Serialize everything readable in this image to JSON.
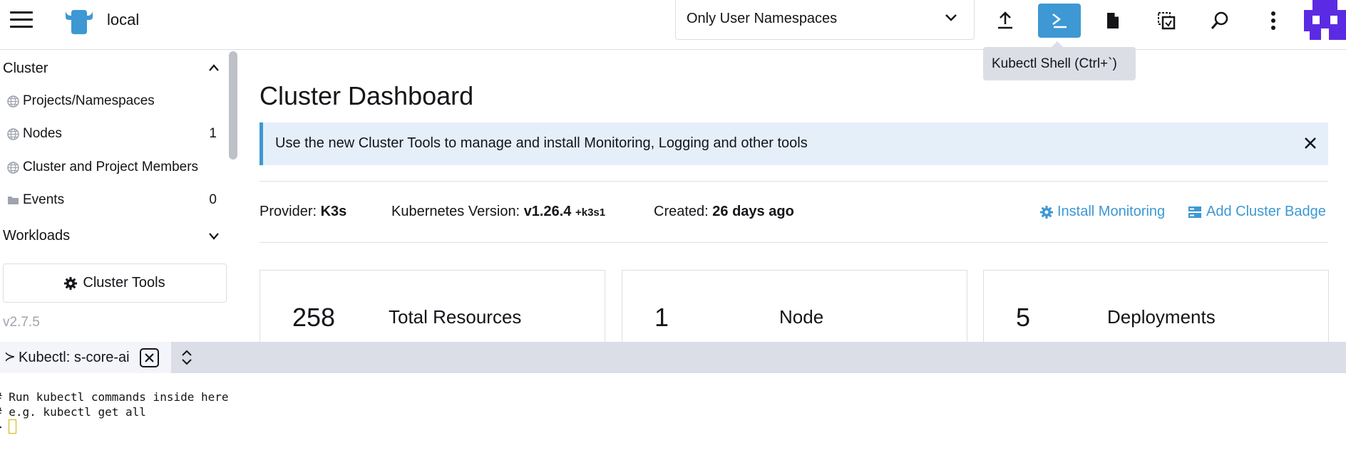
{
  "header": {
    "cluster_name": "local",
    "namespace_filter": "Only User Namespaces",
    "tooltip": "Kubectl Shell (Ctrl+`)",
    "colors": {
      "accent": "#3d98d3",
      "avatar": "#5b2be3"
    },
    "buttons": [
      {
        "name": "import-yaml",
        "icon": "upload-icon"
      },
      {
        "name": "kubectl-shell",
        "icon": "terminal-icon",
        "active": true
      },
      {
        "name": "kubeconfig-download",
        "icon": "file-icon"
      },
      {
        "name": "copy-kubeconfig",
        "icon": "copy-icon"
      },
      {
        "name": "resource-search",
        "icon": "search-icon"
      },
      {
        "name": "more-actions",
        "icon": "more-vertical-icon"
      }
    ]
  },
  "sidebar": {
    "group_cluster": "Cluster",
    "items": [
      {
        "label": "Projects/Namespaces",
        "count": "",
        "icon": "globe-icon"
      },
      {
        "label": "Nodes",
        "count": "1",
        "icon": "globe-icon"
      },
      {
        "label": "Cluster and Project Members",
        "count": "",
        "icon": "globe-icon"
      },
      {
        "label": "Events",
        "count": "0",
        "icon": "folder-icon"
      }
    ],
    "group_workloads": "Workloads",
    "cluster_tools_label": "Cluster Tools",
    "version": "v2.7.5"
  },
  "main": {
    "title": "Cluster Dashboard",
    "banner": "Use the new Cluster Tools to manage and install Monitoring, Logging and other tools",
    "meta": {
      "provider_label": "Provider:",
      "provider_value": "K3s",
      "k8s_label": "Kubernetes Version:",
      "k8s_value": "v1.26.4",
      "k8s_suffix": "+k3s1",
      "created_label": "Created:",
      "created_value": "26 days ago"
    },
    "links": {
      "install_monitoring": "Install Monitoring",
      "add_badge": "Add Cluster Badge"
    },
    "cards": [
      {
        "count": "258",
        "label": "Total Resources"
      },
      {
        "count": "1",
        "label": "Node"
      },
      {
        "count": "5",
        "label": "Deployments"
      }
    ]
  },
  "terminal": {
    "tab_icon": "≻",
    "tab_label": "Kubectl: s-core-ai",
    "lines": [
      "# Run kubectl commands inside here",
      "# e.g. kubectl get all",
      "> "
    ]
  }
}
